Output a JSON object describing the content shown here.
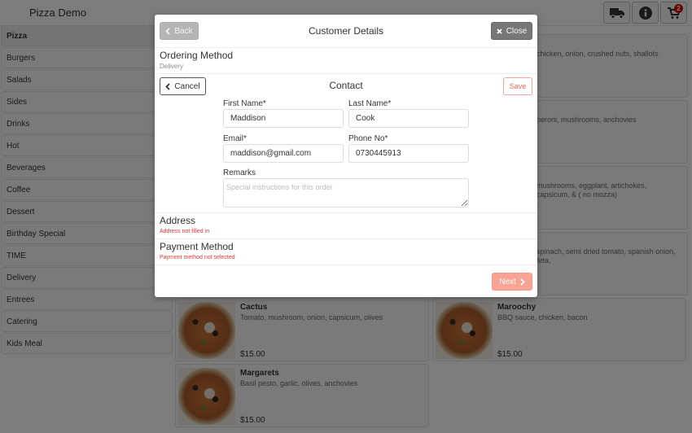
{
  "app": {
    "title": "Pizza Demo"
  },
  "topbar": {
    "icons": [
      {
        "name": "truck-icon",
        "label": "delivery"
      },
      {
        "name": "info-icon",
        "label": "info"
      },
      {
        "name": "cart-icon",
        "label": "cart",
        "badge": "2"
      }
    ]
  },
  "sidebar": {
    "items": [
      {
        "label": "Pizza",
        "active": true
      },
      {
        "label": "Burgers"
      },
      {
        "label": "Salads"
      },
      {
        "label": "Sides"
      },
      {
        "label": "Drinks"
      },
      {
        "label": "Hot"
      },
      {
        "label": "Beverages"
      },
      {
        "label": "Coffee"
      },
      {
        "label": "Dessert"
      },
      {
        "label": "Birthday Special"
      },
      {
        "label": "TIME"
      },
      {
        "label": "Delivery"
      },
      {
        "label": "Entrees"
      },
      {
        "label": "Catering"
      },
      {
        "label": "Kids Meal"
      }
    ]
  },
  "menu": {
    "items": [
      {
        "name": "",
        "desc": "chicken, onion, crushed nuts, shallots",
        "price": ""
      },
      {
        "name": "",
        "desc": "peroni, mushrooms, anchovies",
        "price": ""
      },
      {
        "name": "",
        "desc": "mushrooms, eggplant, artichokes, capsicum, & ( no mozza)",
        "price": ""
      },
      {
        "name": "",
        "desc": "spinach, semi dried tomato, spanish onion, feta,",
        "price": ""
      },
      {
        "name": "Cactus",
        "desc": "Tomato, mushroom, onion, capsicum, olives",
        "price": "$15.00"
      },
      {
        "name": "Maroochy",
        "desc": "BBQ sauce, chicken, bacon",
        "price": "$15.00"
      },
      {
        "name": "Margarets",
        "desc": "Basil pesto, garlic, olives, anchovies",
        "price": "$15.00"
      }
    ]
  },
  "modal": {
    "title": "Customer Details",
    "back_label": "Back",
    "close_label": "Close",
    "ordering": {
      "title": "Ordering Method",
      "value": "Delivery"
    },
    "contact": {
      "title": "Contact",
      "cancel_label": "Cancel",
      "save_label": "Save",
      "first_name": {
        "label": "First Name*",
        "value": "Maddison"
      },
      "last_name": {
        "label": "Last Name*",
        "value": "Cook"
      },
      "email": {
        "label": "Email*",
        "value": "maddison@gmail.com"
      },
      "phone": {
        "label": "Phone No*",
        "value": "0730445913"
      },
      "remarks": {
        "label": "Remarks",
        "value": "",
        "placeholder": "Special instructions for this order"
      }
    },
    "address": {
      "title": "Address",
      "error": "Address not filled in"
    },
    "payment": {
      "title": "Payment Method",
      "error": "Payment method not selected"
    },
    "next_label": "Next"
  },
  "colors": {
    "accent": "#f9a394",
    "error": "#e53935",
    "close_bg": "#777777"
  }
}
